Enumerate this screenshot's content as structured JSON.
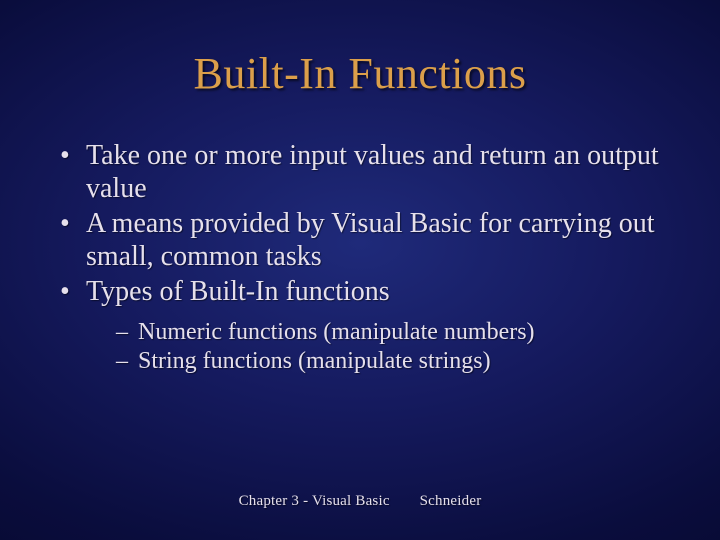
{
  "title": "Built-In Functions",
  "bullets": [
    {
      "text": "Take one or more input values and return an output value"
    },
    {
      "text": "A means provided by Visual Basic for carrying out small, common tasks"
    },
    {
      "text": "Types of Built-In functions",
      "sub": [
        "Numeric functions (manipulate numbers)",
        "String functions (manipulate strings)"
      ]
    }
  ],
  "footer": {
    "left": "Chapter 3 - Visual Basic",
    "right": "Schneider"
  }
}
